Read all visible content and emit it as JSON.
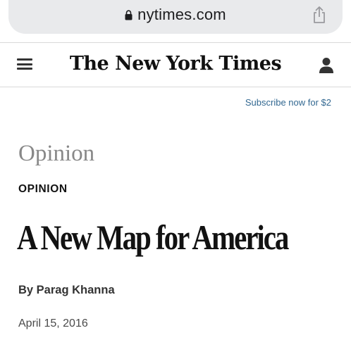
{
  "browser": {
    "url": "nytimes.com",
    "lock_icon": "lock-icon",
    "share_icon": "share-icon"
  },
  "header": {
    "masthead": "The New York Times",
    "menu_icon": "hamburger-menu-icon",
    "account_icon": "user-icon"
  },
  "subscribe": {
    "label": "Subscribe now for $2"
  },
  "article": {
    "section": "Opinion",
    "kicker": "OPINION",
    "headline": "A New Map for America",
    "byline": "By Parag Khanna",
    "date": "April 15, 2016"
  },
  "colors": {
    "link": "#326891",
    "urlbar_bg": "#e9eaec",
    "section_gray": "#888888"
  }
}
